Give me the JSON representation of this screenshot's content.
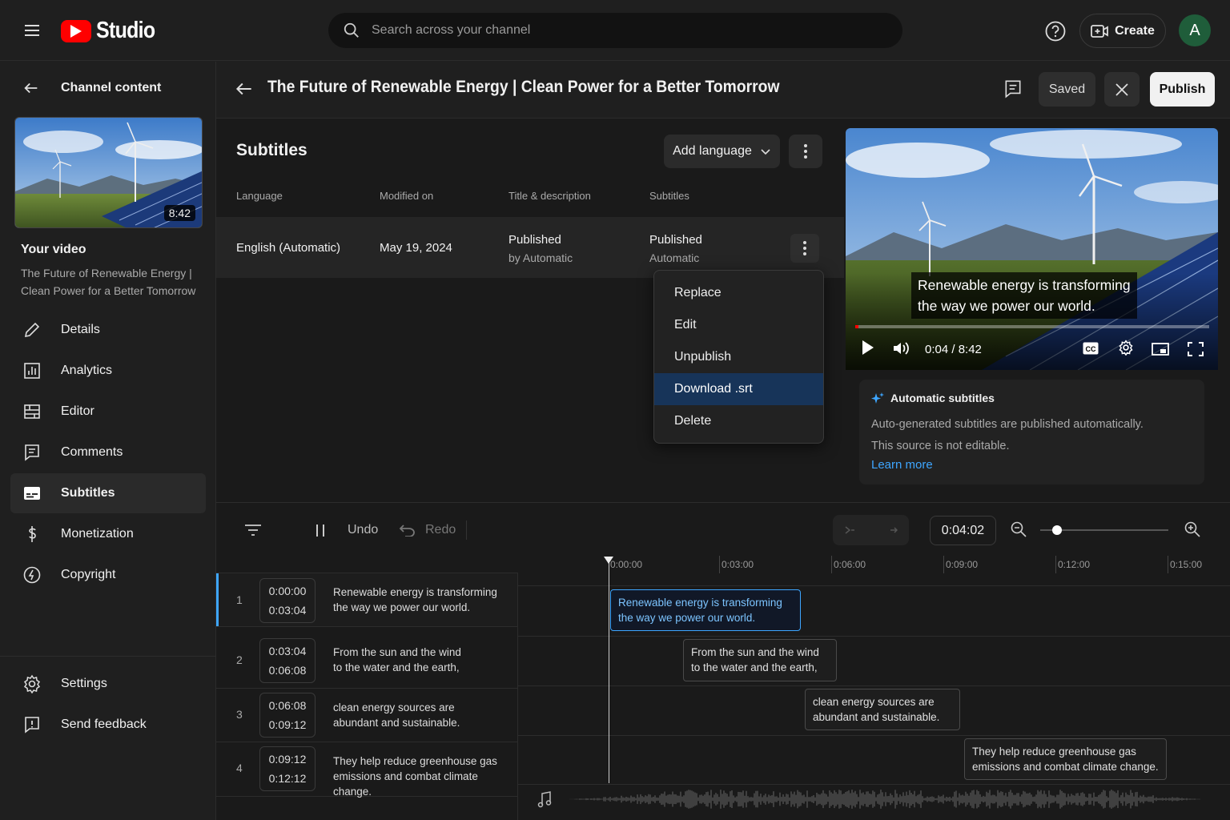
{
  "topbar": {
    "logo_text": "Studio",
    "search_placeholder": "Search across your channel",
    "create_label": "Create",
    "avatar_letter": "A"
  },
  "sidebar": {
    "back_label": "Channel content",
    "thumb_duration": "8:42",
    "your_video_label": "Your video",
    "video_title": "The Future of Renewable Energy | Clean Power for a Better Tomorrow",
    "items": [
      {
        "label": "Details",
        "icon": "pencil-icon"
      },
      {
        "label": "Analytics",
        "icon": "analytics-icon"
      },
      {
        "label": "Editor",
        "icon": "editor-icon"
      },
      {
        "label": "Comments",
        "icon": "comments-icon"
      },
      {
        "label": "Subtitles",
        "icon": "subtitles-icon",
        "active": true
      },
      {
        "label": "Monetization",
        "icon": "dollar-icon"
      },
      {
        "label": "Copyright",
        "icon": "copyright-icon"
      }
    ],
    "bottom": [
      {
        "label": "Settings",
        "icon": "gear-icon"
      },
      {
        "label": "Send feedback",
        "icon": "feedback-icon"
      }
    ]
  },
  "header": {
    "title": "The Future of Renewable Energy | Clean Power for a Better Tomorrow",
    "saved_label": "Saved",
    "publish_label": "Publish"
  },
  "subtitles": {
    "title": "Subtitles",
    "add_language_label": "Add language",
    "columns": [
      "Language",
      "Modified on",
      "Title & description",
      "Subtitles"
    ],
    "row": {
      "language": "English (Automatic)",
      "modified": "May 19, 2024",
      "title_status": "Published",
      "title_by": "by Automatic",
      "subs_status": "Published",
      "subs_by": "Automatic"
    }
  },
  "menu": {
    "items": [
      "Replace",
      "Edit",
      "Unpublish",
      "Download .srt",
      "Delete"
    ],
    "highlighted": "Download .srt"
  },
  "player": {
    "caption_line1": "Renewable energy is transforming",
    "caption_line2": "the way we power our world.",
    "time": "0:04 / 8:42",
    "progress_fraction": 0.008
  },
  "info": {
    "title": "Automatic subtitles",
    "line1": "Auto-generated subtitles are published automatically.",
    "line2": "This source is not editable.",
    "link": "Learn more"
  },
  "timeline": {
    "undo_label": "Undo",
    "redo_label": "Redo",
    "current_time": "0:04:02",
    "ticks": [
      "0:00:00",
      "0:03:00",
      "0:06:00",
      "0:09:00",
      "0:12:00",
      "0:15:00"
    ],
    "zoom_fraction": 0.1,
    "cues": [
      {
        "num": "1",
        "start": "0:00:00",
        "end": "0:03:04",
        "line1": "Renewable energy is transforming",
        "line2": "the way we power our world."
      },
      {
        "num": "2",
        "start": "0:03:04",
        "end": "0:06:08",
        "line1": "From the sun and the wind",
        "line2": "to the water and the earth,"
      },
      {
        "num": "3",
        "start": "0:06:08",
        "end": "0:09:12",
        "line1": "clean energy sources are",
        "line2": "abundant and sustainable."
      },
      {
        "num": "4",
        "start": "0:09:12",
        "end": "0:12:12",
        "line1": "They help reduce greenhouse gas",
        "line2": "emissions and combat climate change."
      }
    ]
  }
}
